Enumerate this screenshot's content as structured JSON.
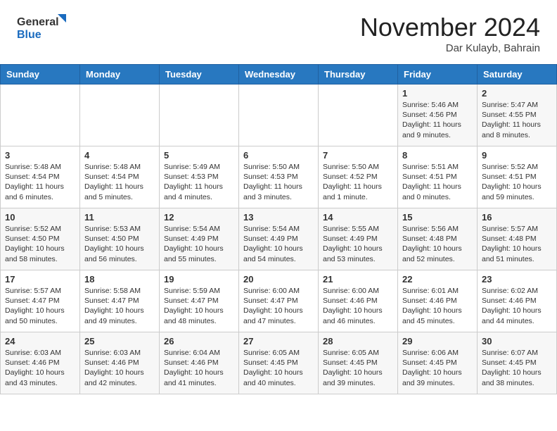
{
  "header": {
    "logo_line1": "General",
    "logo_line2": "Blue",
    "month": "November 2024",
    "location": "Dar Kulayb, Bahrain"
  },
  "days_of_week": [
    "Sunday",
    "Monday",
    "Tuesday",
    "Wednesday",
    "Thursday",
    "Friday",
    "Saturday"
  ],
  "weeks": [
    [
      {
        "day": "",
        "info": ""
      },
      {
        "day": "",
        "info": ""
      },
      {
        "day": "",
        "info": ""
      },
      {
        "day": "",
        "info": ""
      },
      {
        "day": "",
        "info": ""
      },
      {
        "day": "1",
        "info": "Sunrise: 5:46 AM\nSunset: 4:56 PM\nDaylight: 11 hours and 9 minutes."
      },
      {
        "day": "2",
        "info": "Sunrise: 5:47 AM\nSunset: 4:55 PM\nDaylight: 11 hours and 8 minutes."
      }
    ],
    [
      {
        "day": "3",
        "info": "Sunrise: 5:48 AM\nSunset: 4:54 PM\nDaylight: 11 hours and 6 minutes."
      },
      {
        "day": "4",
        "info": "Sunrise: 5:48 AM\nSunset: 4:54 PM\nDaylight: 11 hours and 5 minutes."
      },
      {
        "day": "5",
        "info": "Sunrise: 5:49 AM\nSunset: 4:53 PM\nDaylight: 11 hours and 4 minutes."
      },
      {
        "day": "6",
        "info": "Sunrise: 5:50 AM\nSunset: 4:53 PM\nDaylight: 11 hours and 3 minutes."
      },
      {
        "day": "7",
        "info": "Sunrise: 5:50 AM\nSunset: 4:52 PM\nDaylight: 11 hours and 1 minute."
      },
      {
        "day": "8",
        "info": "Sunrise: 5:51 AM\nSunset: 4:51 PM\nDaylight: 11 hours and 0 minutes."
      },
      {
        "day": "9",
        "info": "Sunrise: 5:52 AM\nSunset: 4:51 PM\nDaylight: 10 hours and 59 minutes."
      }
    ],
    [
      {
        "day": "10",
        "info": "Sunrise: 5:52 AM\nSunset: 4:50 PM\nDaylight: 10 hours and 58 minutes."
      },
      {
        "day": "11",
        "info": "Sunrise: 5:53 AM\nSunset: 4:50 PM\nDaylight: 10 hours and 56 minutes."
      },
      {
        "day": "12",
        "info": "Sunrise: 5:54 AM\nSunset: 4:49 PM\nDaylight: 10 hours and 55 minutes."
      },
      {
        "day": "13",
        "info": "Sunrise: 5:54 AM\nSunset: 4:49 PM\nDaylight: 10 hours and 54 minutes."
      },
      {
        "day": "14",
        "info": "Sunrise: 5:55 AM\nSunset: 4:49 PM\nDaylight: 10 hours and 53 minutes."
      },
      {
        "day": "15",
        "info": "Sunrise: 5:56 AM\nSunset: 4:48 PM\nDaylight: 10 hours and 52 minutes."
      },
      {
        "day": "16",
        "info": "Sunrise: 5:57 AM\nSunset: 4:48 PM\nDaylight: 10 hours and 51 minutes."
      }
    ],
    [
      {
        "day": "17",
        "info": "Sunrise: 5:57 AM\nSunset: 4:47 PM\nDaylight: 10 hours and 50 minutes."
      },
      {
        "day": "18",
        "info": "Sunrise: 5:58 AM\nSunset: 4:47 PM\nDaylight: 10 hours and 49 minutes."
      },
      {
        "day": "19",
        "info": "Sunrise: 5:59 AM\nSunset: 4:47 PM\nDaylight: 10 hours and 48 minutes."
      },
      {
        "day": "20",
        "info": "Sunrise: 6:00 AM\nSunset: 4:47 PM\nDaylight: 10 hours and 47 minutes."
      },
      {
        "day": "21",
        "info": "Sunrise: 6:00 AM\nSunset: 4:46 PM\nDaylight: 10 hours and 46 minutes."
      },
      {
        "day": "22",
        "info": "Sunrise: 6:01 AM\nSunset: 4:46 PM\nDaylight: 10 hours and 45 minutes."
      },
      {
        "day": "23",
        "info": "Sunrise: 6:02 AM\nSunset: 4:46 PM\nDaylight: 10 hours and 44 minutes."
      }
    ],
    [
      {
        "day": "24",
        "info": "Sunrise: 6:03 AM\nSunset: 4:46 PM\nDaylight: 10 hours and 43 minutes."
      },
      {
        "day": "25",
        "info": "Sunrise: 6:03 AM\nSunset: 4:46 PM\nDaylight: 10 hours and 42 minutes."
      },
      {
        "day": "26",
        "info": "Sunrise: 6:04 AM\nSunset: 4:46 PM\nDaylight: 10 hours and 41 minutes."
      },
      {
        "day": "27",
        "info": "Sunrise: 6:05 AM\nSunset: 4:45 PM\nDaylight: 10 hours and 40 minutes."
      },
      {
        "day": "28",
        "info": "Sunrise: 6:05 AM\nSunset: 4:45 PM\nDaylight: 10 hours and 39 minutes."
      },
      {
        "day": "29",
        "info": "Sunrise: 6:06 AM\nSunset: 4:45 PM\nDaylight: 10 hours and 39 minutes."
      },
      {
        "day": "30",
        "info": "Sunrise: 6:07 AM\nSunset: 4:45 PM\nDaylight: 10 hours and 38 minutes."
      }
    ]
  ]
}
